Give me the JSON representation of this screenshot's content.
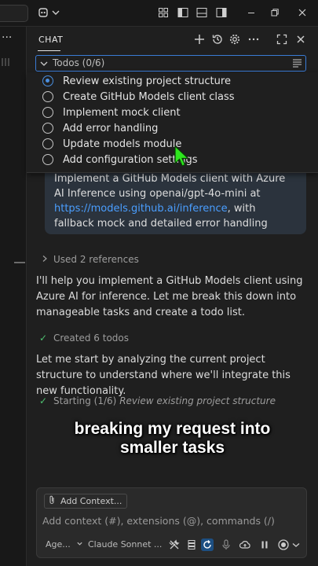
{
  "titlebar": {
    "icons": [
      "copilot-icon",
      "chevron-down-icon",
      "customize-layout-icon",
      "toggle-sidebar-icon",
      "toggle-panel-icon",
      "toggle-secondary-sidebar-icon",
      "minimize-icon",
      "restore-icon",
      "close-icon"
    ]
  },
  "leftstrip": {
    "dots": "···"
  },
  "chat": {
    "title": "CHAT",
    "header_icons": [
      "new-chat-icon",
      "history-icon",
      "settings-icon",
      "more-icon",
      "maximize-icon",
      "close-icon"
    ]
  },
  "todos": {
    "header": "Todos (0/6)",
    "items": [
      {
        "label": "Review existing project structure",
        "status": "in-progress"
      },
      {
        "label": "Create GitHub Models client class",
        "status": "not-started"
      },
      {
        "label": "Implement mock client",
        "status": "not-started"
      },
      {
        "label": "Add error handling",
        "status": "not-started"
      },
      {
        "label": "Update models module",
        "status": "not-started"
      },
      {
        "label": "Add configuration settings",
        "status": "not-started"
      }
    ]
  },
  "request": {
    "text_before": "Implement a GitHub Models client with Azure AI Inference using openai/gpt-4o-mini at ",
    "link": "https://models.github.ai/inference",
    "text_after": ", with fallback mock and detailed error handling"
  },
  "references": {
    "label": "Used 2 references"
  },
  "messages": {
    "m1": "I'll help you implement a GitHub Models client using Azure AI for inference. Let me break this down into manageable tasks and create a todo list.",
    "m2": "Let me start by analyzing the current project structure to understand where we'll integrate this new functionality."
  },
  "statuses": {
    "created": "Created 6 todos",
    "starting_prefix": "Starting (1/6) ",
    "starting_task": "Review existing project structure"
  },
  "caption": {
    "line1": "breaking my request into",
    "line2": "smaller tasks"
  },
  "input": {
    "add_context": "Add Context...",
    "placeholder": "Add context (#), extensions (@), commands (/)",
    "mode": "Age...",
    "model": "Claude Sonnet ...",
    "accent": "#1d4f82"
  },
  "colors": {
    "accent_blue": "#4a8fe0",
    "link": "#4a9eff",
    "success": "#4ec070",
    "bubble": "#2b333d"
  }
}
